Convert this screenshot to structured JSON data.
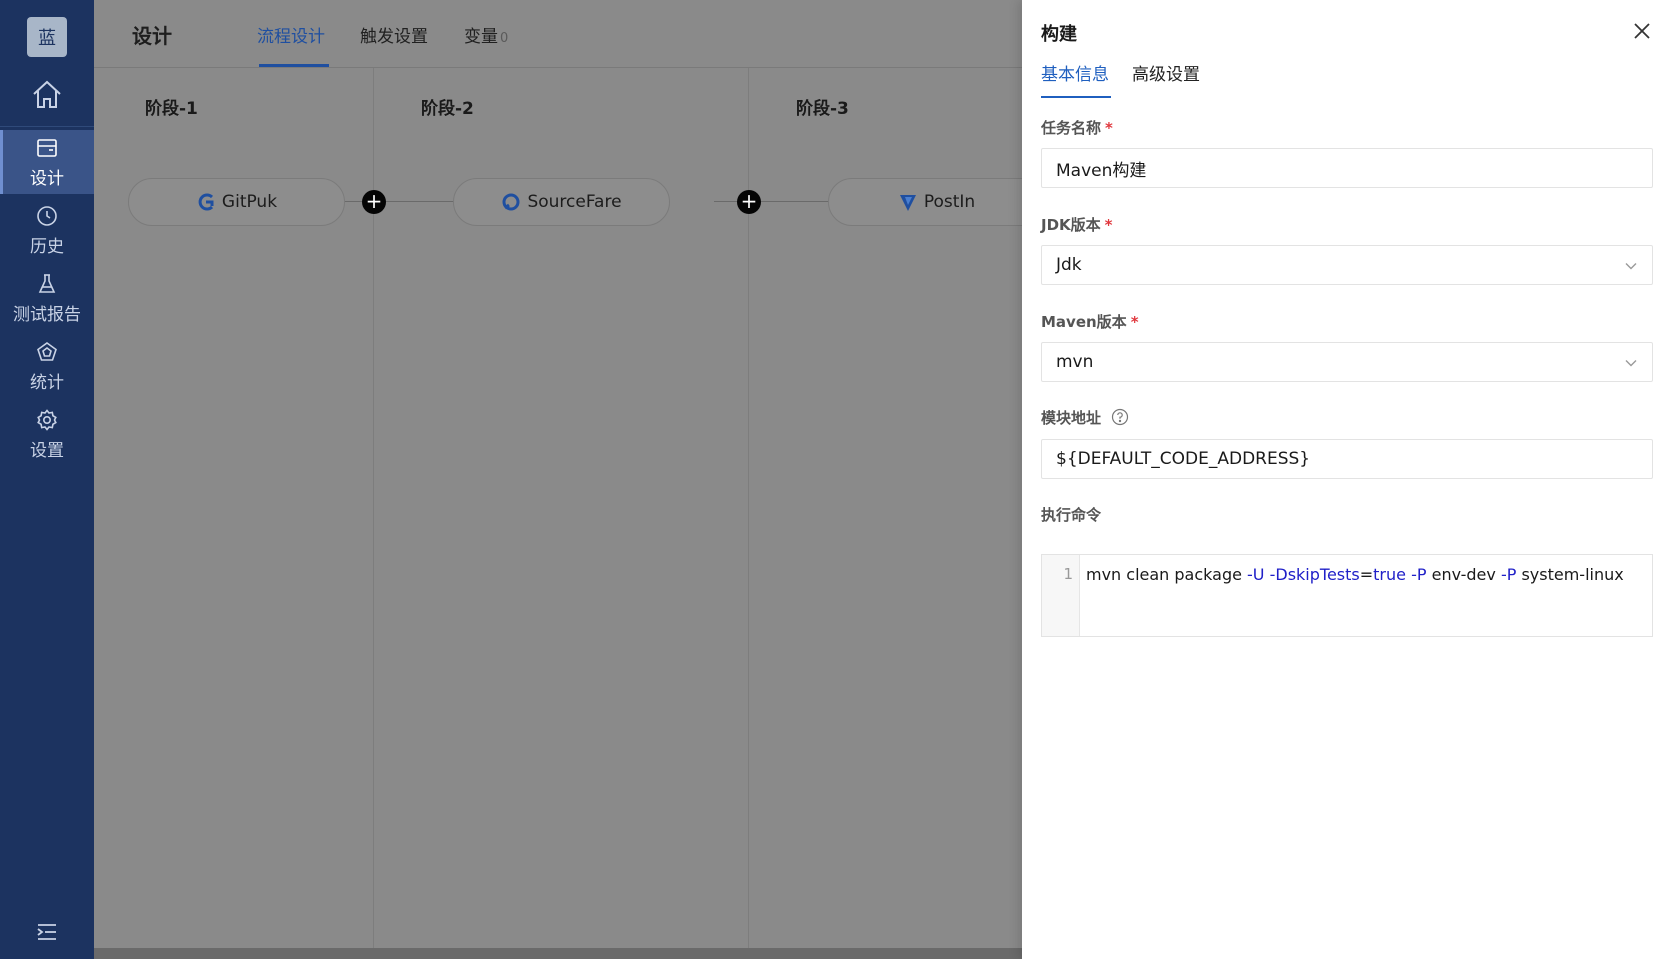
{
  "sidebar": {
    "logo_text": "蓝",
    "items": [
      {
        "label": "设计",
        "icon": "board-icon",
        "active": true
      },
      {
        "label": "历史",
        "icon": "clock-icon",
        "active": false
      },
      {
        "label": "测试报告",
        "icon": "flask-icon",
        "active": false
      },
      {
        "label": "统计",
        "icon": "pentagon-chart-icon",
        "active": false
      },
      {
        "label": "设置",
        "icon": "gear-icon",
        "active": false
      }
    ]
  },
  "header": {
    "title": "设计",
    "tabs": [
      {
        "label": "流程设计",
        "active": true
      },
      {
        "label": "触发设置",
        "active": false
      },
      {
        "label": "变量",
        "active": false,
        "count": "0"
      }
    ]
  },
  "stages": [
    {
      "title": "阶段-1",
      "task": "GitPuk",
      "icon": "gitpuk-icon"
    },
    {
      "title": "阶段-2",
      "task": "SourceFare",
      "icon": "sourcefare-icon"
    },
    {
      "title": "阶段-3",
      "task": "PostIn",
      "icon": "postin-icon"
    }
  ],
  "drawer": {
    "title": "构建",
    "tabs": [
      {
        "label": "基本信息",
        "active": true
      },
      {
        "label": "高级设置",
        "active": false
      }
    ],
    "fields": {
      "task_name": {
        "label": "任务名称",
        "required": "*",
        "value": "Maven构建"
      },
      "jdk": {
        "label": "JDK版本",
        "required": "*",
        "value": "Jdk"
      },
      "maven": {
        "label": "Maven版本",
        "required": "*",
        "value": "mvn"
      },
      "module": {
        "label": "模块地址",
        "value": "${DEFAULT_CODE_ADDRESS}"
      },
      "command": {
        "label": "执行命令",
        "line_number": "1",
        "code_parts": [
          "mvn clean package ",
          "-U",
          " ",
          "-DskipTests",
          "=",
          "true",
          " ",
          "-P",
          " env-dev ",
          "-P",
          " system-linux"
        ]
      }
    }
  },
  "colors": {
    "sidebar_bg": "#1c3360",
    "accent": "#1f5fbf",
    "required": "#e0383e",
    "overlay": "#8a8a8a"
  }
}
